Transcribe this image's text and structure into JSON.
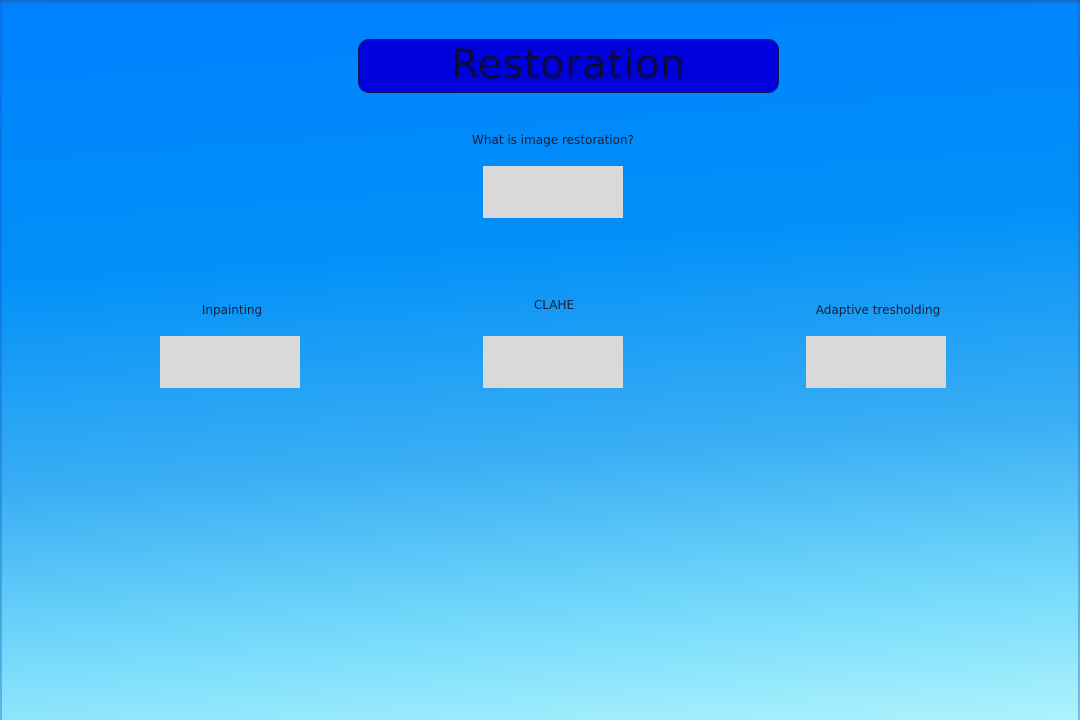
{
  "header": {
    "title": "Restoration"
  },
  "intro": {
    "question": "What is image restoration?"
  },
  "sections": [
    {
      "label": "Inpainting"
    },
    {
      "label": "CLAHE"
    },
    {
      "label": "Adaptive tresholding"
    }
  ],
  "colors": {
    "title_box": "#0000dd",
    "button_fill": "#d9d9d9",
    "background_top": "#0080ff",
    "background_bottom": "#aef2fd"
  }
}
